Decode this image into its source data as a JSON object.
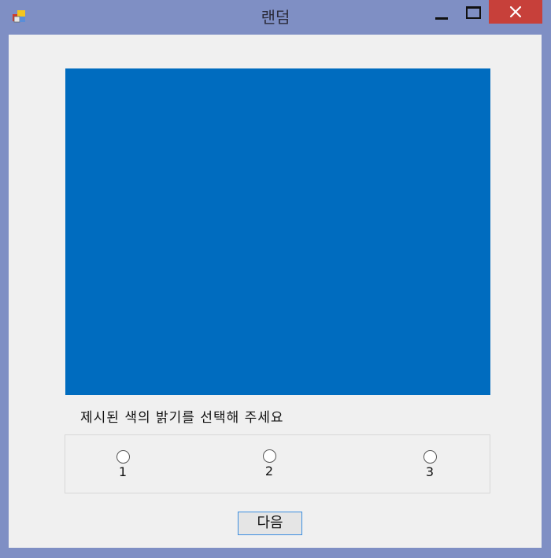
{
  "window": {
    "title": "랜덤",
    "icon": "windows-form-icon",
    "controls": [
      "minimize-icon",
      "maximize-icon",
      "close-icon"
    ]
  },
  "swatch": {
    "color": "#006cbf"
  },
  "prompt": "제시된 색의 밝기를 선택해 주세요",
  "options": [
    {
      "label": "1",
      "selected": false
    },
    {
      "label": "2",
      "selected": false
    },
    {
      "label": "3",
      "selected": false
    }
  ],
  "next_button": "다음",
  "colors": {
    "titlebar": "#7f8fc4",
    "close": "#c7403a",
    "client": "#f0f0f0",
    "button_border": "#3c8ee0"
  }
}
